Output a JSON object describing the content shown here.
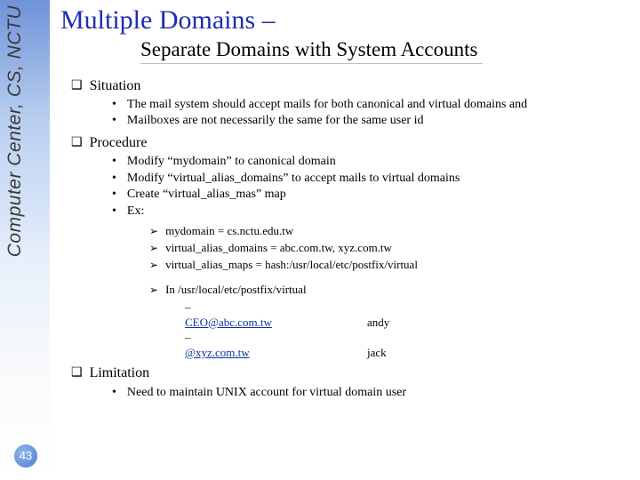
{
  "sidebar_text": "Computer Center, CS, NCTU",
  "page_number": "43",
  "title": "Multiple Domains –",
  "subtitle": "Separate Domains with System Accounts",
  "sections": {
    "situation": {
      "heading": "Situation",
      "items": [
        "The mail system should accept mails for both canonical and virtual domains and",
        "Mailboxes are not necessarily the same for the same user id"
      ]
    },
    "procedure": {
      "heading": "Procedure",
      "items": [
        "Modify “mydomain” to canonical domain",
        "Modify “virtual_alias_domains” to accept mails to virtual domains",
        "Create “virtual_alias_mas” map",
        "Ex:"
      ],
      "examples_top": [
        "mydomain = cs.nctu.edu.tw",
        "virtual_alias_domains = abc.com.tw, xyz.com.tw",
        "virtual_alias_maps = hash:/usr/local/etc/postfix/virtual"
      ],
      "example_in_header": "In /usr/local/etc/postfix/virtual",
      "mappings": [
        {
          "email": "CEO@abc.com.tw",
          "user": "andy"
        },
        {
          "email": "@xyz.com.tw",
          "user": "jack"
        }
      ]
    },
    "limitation": {
      "heading": "Limitation",
      "items": [
        "Need to maintain UNIX account for virtual domain user"
      ]
    }
  }
}
